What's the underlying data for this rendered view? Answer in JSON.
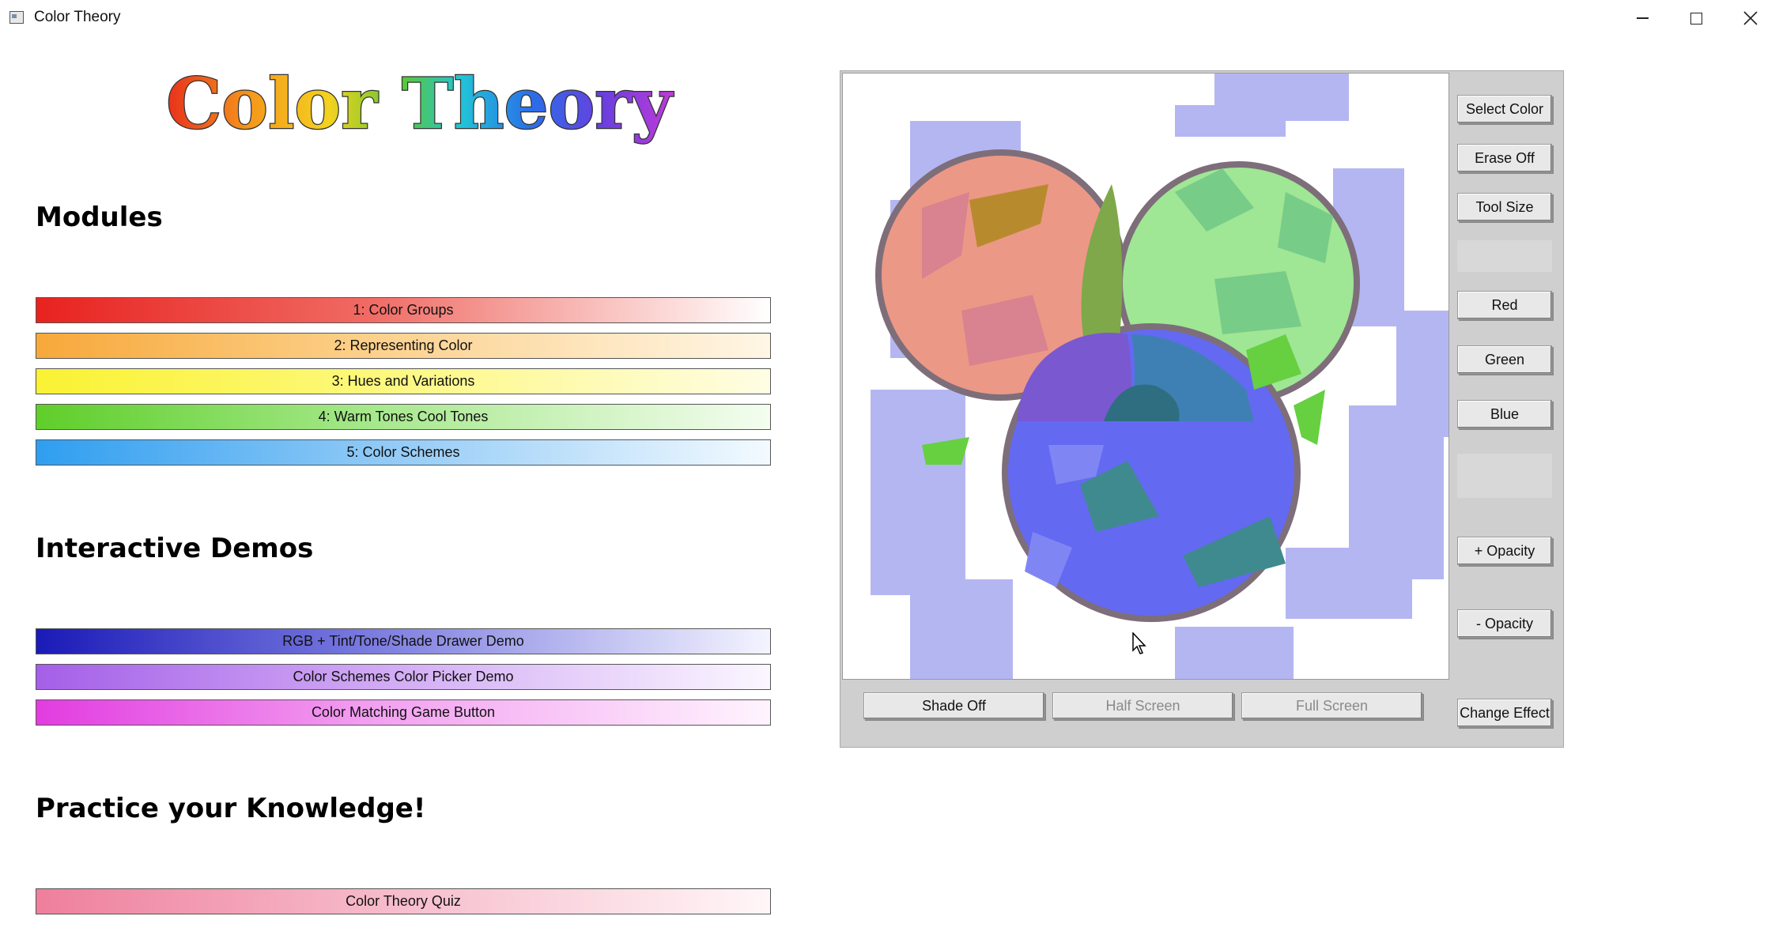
{
  "window": {
    "title": "Color Theory"
  },
  "logo": {
    "text": "Color Theory"
  },
  "modules": {
    "heading": "Modules",
    "items": [
      {
        "label": "1: Color Groups"
      },
      {
        "label": "2: Representing Color"
      },
      {
        "label": "3: Hues and Variations"
      },
      {
        "label": "4: Warm Tones  Cool Tones"
      },
      {
        "label": "5: Color Schemes"
      }
    ]
  },
  "demos": {
    "heading": "Interactive Demos",
    "items": [
      {
        "label": "RGB + Tint/Tone/Shade Drawer Demo"
      },
      {
        "label": "Color Schemes Color Picker Demo"
      },
      {
        "label": "Color Matching Game Button"
      }
    ]
  },
  "practice": {
    "heading": "Practice your Knowledge!",
    "items": [
      {
        "label": "Color Theory Quiz"
      }
    ]
  },
  "drawer": {
    "side_buttons": {
      "select_color": "Select Color",
      "erase": "Erase Off",
      "tool_size": "Tool Size",
      "red": "Red",
      "green": "Green",
      "blue": "Blue",
      "plus_opacity": "+ Opacity",
      "minus_opacity": "- Opacity",
      "change_effect": "Change Effect"
    },
    "bottom_buttons": {
      "shade": "Shade Off",
      "half_screen": "Half Screen",
      "full_screen": "Full Screen"
    }
  },
  "colors": {
    "circle_red": "#ec9886",
    "circle_green": "#9fe695",
    "circle_blue": "#6469f2",
    "background_strokes": "#b4b6f2",
    "overlap_rg": "#7ea84a",
    "overlap_rb": "#7a58cf",
    "overlap_gb": "#3f80b4",
    "center": "#2e6e80"
  }
}
